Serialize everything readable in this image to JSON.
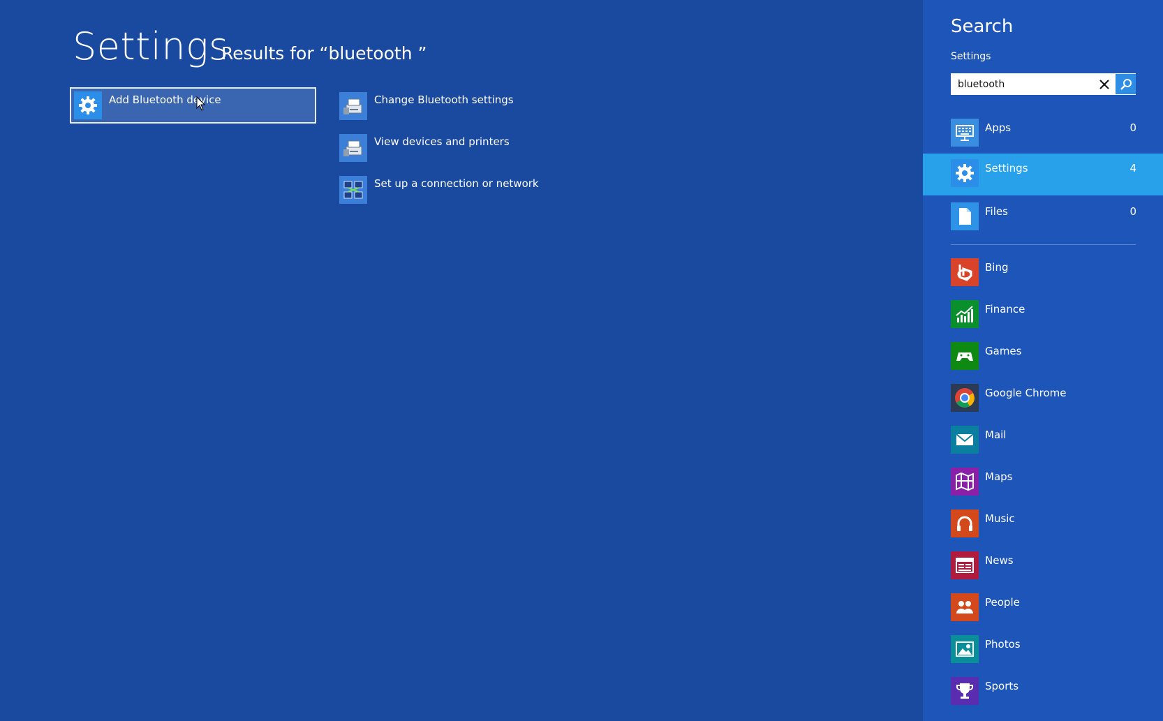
{
  "main": {
    "title": "Settings",
    "results_for": "Results for “bluetooth ”",
    "results": [
      {
        "label": "Add Bluetooth device",
        "icon": "gear-icon"
      },
      {
        "label": "Change Bluetooth settings",
        "icon": "devices-printers-icon"
      },
      {
        "label": "View devices and printers",
        "icon": "devices-printers-icon"
      },
      {
        "label": "Set up a connection or network",
        "icon": "network-icon"
      }
    ]
  },
  "charm": {
    "title": "Search",
    "scope": "Settings",
    "search": {
      "value": "bluetooth",
      "placeholder": ""
    },
    "scopes": [
      {
        "label": "Apps",
        "count": "0",
        "icon": "apps-icon"
      },
      {
        "label": "Settings",
        "count": "4",
        "icon": "gear-icon"
      },
      {
        "label": "Files",
        "count": "0",
        "icon": "file-icon"
      }
    ],
    "apps": [
      {
        "label": "Bing",
        "icon": "bing-icon",
        "color": "#d9432a"
      },
      {
        "label": "Finance",
        "icon": "finance-icon",
        "color": "#0a8f2d"
      },
      {
        "label": "Games",
        "icon": "games-icon",
        "color": "#0e8a12"
      },
      {
        "label": "Google Chrome",
        "icon": "chrome-icon",
        "color": "#2b3a55"
      },
      {
        "label": "Mail",
        "icon": "mail-icon",
        "color": "#0a7fa0"
      },
      {
        "label": "Maps",
        "icon": "maps-icon",
        "color": "#8a1fa8"
      },
      {
        "label": "Music",
        "icon": "music-icon",
        "color": "#d4491c"
      },
      {
        "label": "News",
        "icon": "news-icon",
        "color": "#b01b3e"
      },
      {
        "label": "People",
        "icon": "people-icon",
        "color": "#d4491c"
      },
      {
        "label": "Photos",
        "icon": "photos-icon",
        "color": "#0a8f9a"
      },
      {
        "label": "Sports",
        "icon": "sports-icon",
        "color": "#5a2db0"
      }
    ]
  },
  "colors": {
    "background": "#1a4aa0",
    "charm_background": "#1d55b8",
    "active_scope": "#28a0ea"
  }
}
